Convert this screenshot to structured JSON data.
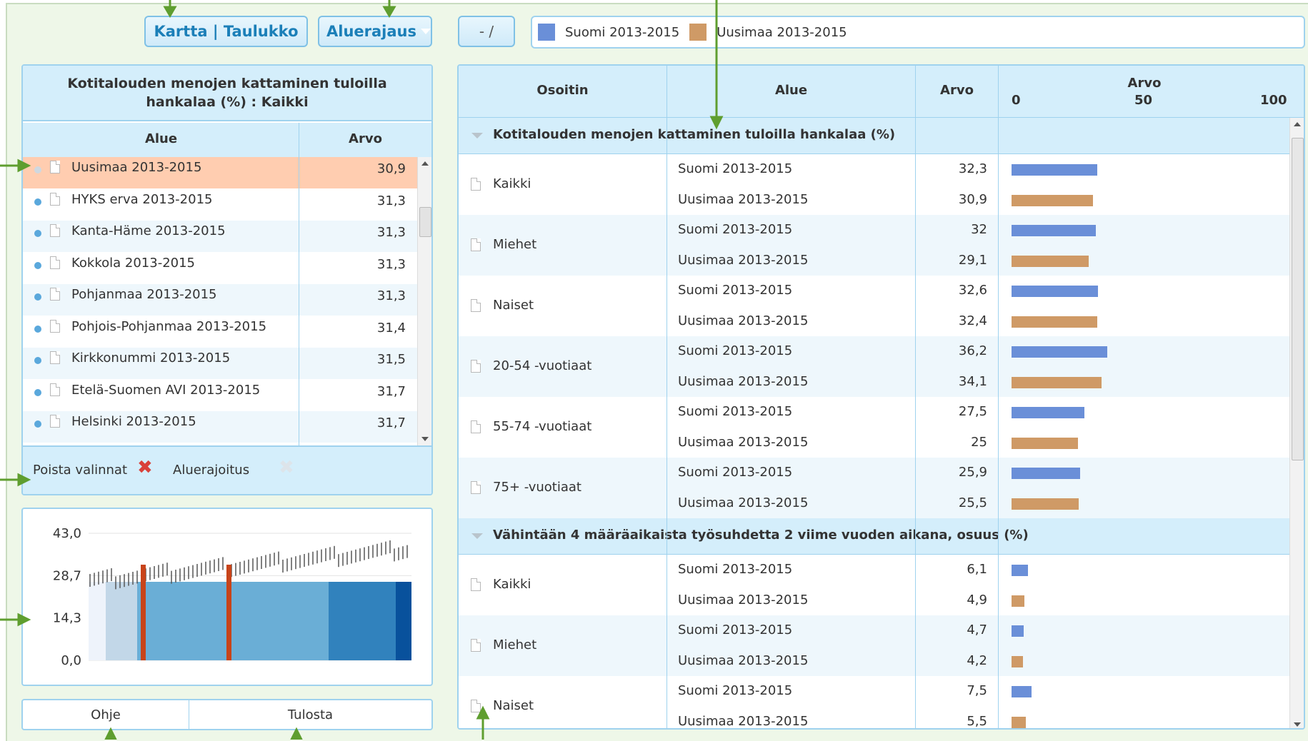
{
  "toolbar": {
    "view_toggle": "Kartta | Taulukko",
    "area_filter": "Aluerajaus",
    "zoom_btn": "- /"
  },
  "legend": [
    {
      "label": "Suomi 2013-2015",
      "color": "#6a8fd8"
    },
    {
      "label": "Uusimaa 2013-2015",
      "color": "#cf9a66"
    }
  ],
  "left": {
    "title": "Kotitalouden menojen kattaminen tuloilla hankalaa (%) : Kaikki",
    "col_area": "Alue",
    "col_value": "Arvo",
    "rows": [
      {
        "area": "Uusimaa 2013-2015",
        "value": "30,9"
      },
      {
        "area": "HYKS erva 2013-2015",
        "value": "31,3"
      },
      {
        "area": "Kanta-Häme 2013-2015",
        "value": "31,3"
      },
      {
        "area": "Kokkola 2013-2015",
        "value": "31,3"
      },
      {
        "area": "Pohjanmaa 2013-2015",
        "value": "31,3"
      },
      {
        "area": "Pohjois-Pohjanmaa 2013-2015",
        "value": "31,4"
      },
      {
        "area": "Kirkkonummi 2013-2015",
        "value": "31,5"
      },
      {
        "area": "Etelä-Suomen AVI 2013-2015",
        "value": "31,7"
      },
      {
        "area": "Helsinki 2013-2015",
        "value": "31,7"
      }
    ],
    "clear_label": "Poista valinnat",
    "filter_label": "Aluerajoitus",
    "help": "Ohje",
    "print": "Tulosta"
  },
  "chart_data": {
    "type": "bar",
    "ylim": [
      0,
      43
    ],
    "yticks": [
      "43,0",
      "28,7",
      "14,3",
      "0,0"
    ]
  },
  "right": {
    "col_indicator": "Osoitin",
    "col_area": "Alue",
    "col_value": "Arvo",
    "col_bar": "Arvo",
    "bar_ticks": [
      "0",
      "50",
      "100"
    ],
    "groups": [
      {
        "title": "Kotitalouden menojen kattaminen tuloilla hankalaa (%)",
        "items": [
          {
            "label": "Kaikki",
            "s": "32,3",
            "u": "30,9",
            "sv": 32.3,
            "uv": 30.9
          },
          {
            "label": "Miehet",
            "s": "32",
            "u": "29,1",
            "sv": 32,
            "uv": 29.1
          },
          {
            "label": "Naiset",
            "s": "32,6",
            "u": "32,4",
            "sv": 32.6,
            "uv": 32.4
          },
          {
            "label": "20-54 -vuotiaat",
            "s": "36,2",
            "u": "34,1",
            "sv": 36.2,
            "uv": 34.1
          },
          {
            "label": "55-74 -vuotiaat",
            "s": "27,5",
            "u": "25",
            "sv": 27.5,
            "uv": 25
          },
          {
            "label": "75+ -vuotiaat",
            "s": "25,9",
            "u": "25,5",
            "sv": 25.9,
            "uv": 25.5
          }
        ]
      },
      {
        "title": "Vähintään 4 määräaikaista työsuhdetta 2 viime vuoden aikana, osuus (%)",
        "items": [
          {
            "label": "Kaikki",
            "s": "6,1",
            "u": "4,9",
            "sv": 6.1,
            "uv": 4.9
          },
          {
            "label": "Miehet",
            "s": "4,7",
            "u": "4,2",
            "sv": 4.7,
            "uv": 4.2
          },
          {
            "label": "Naiset",
            "s": "7,5",
            "u": "5,5",
            "sv": 7.5,
            "uv": 5.5
          }
        ]
      }
    ],
    "area_s": "Suomi 2013-2015",
    "area_u": "Uusimaa 2013-2015"
  }
}
